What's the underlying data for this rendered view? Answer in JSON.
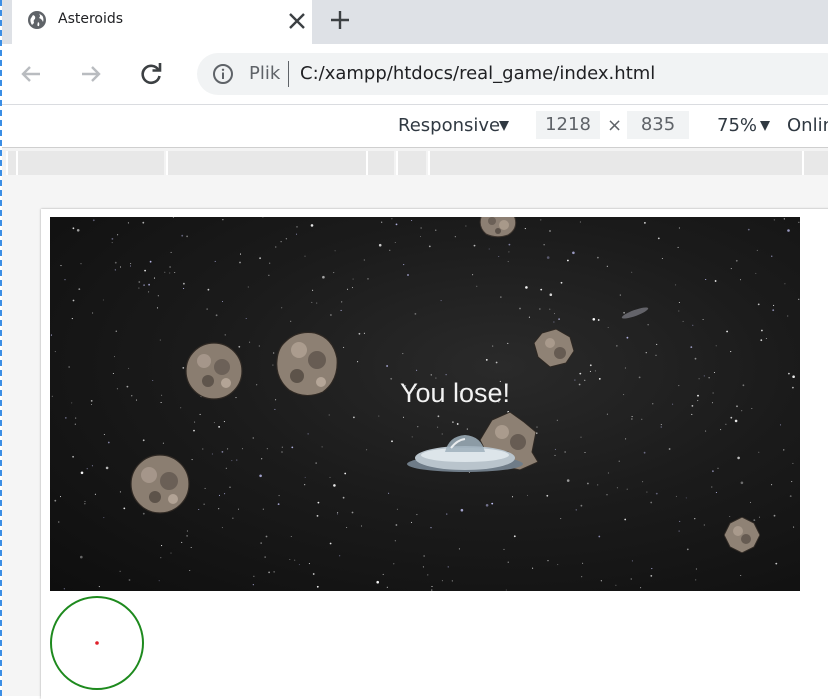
{
  "tab": {
    "title": "Asteroids",
    "favicon": "globe-icon",
    "close": "close-icon",
    "new_tab": "plus-icon"
  },
  "toolbar": {
    "back": "arrow-left-icon",
    "forward": "arrow-right-icon",
    "reload": "reload-icon",
    "info": "info-icon",
    "scheme_label": "Plik",
    "url": "C:/xampp/htdocs/real_game/index.html"
  },
  "device_toolbar": {
    "mode": "Responsive",
    "width": "1218",
    "times": "×",
    "height": "835",
    "zoom": "75%",
    "throttle": "Online"
  },
  "game": {
    "message": "You lose!",
    "player": "ufo-ship",
    "asteroid_count": 8
  },
  "colors": {
    "tabstrip": "#dee1e6",
    "omnibox": "#f1f3f4",
    "radar_ring": "#1e8a1e",
    "radar_dot": "#e0202a",
    "viewport_guide": "#3b8ee5"
  }
}
